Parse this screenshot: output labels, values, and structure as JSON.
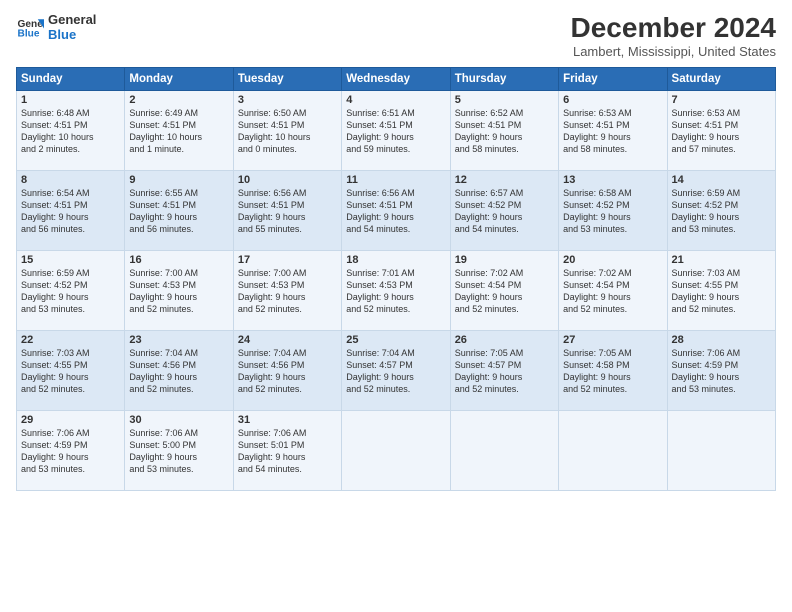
{
  "logo": {
    "line1": "General",
    "line2": "Blue"
  },
  "title": "December 2024",
  "subtitle": "Lambert, Mississippi, United States",
  "columns": [
    "Sunday",
    "Monday",
    "Tuesday",
    "Wednesday",
    "Thursday",
    "Friday",
    "Saturday"
  ],
  "weeks": [
    [
      {
        "day": "1",
        "info": "Sunrise: 6:48 AM\nSunset: 4:51 PM\nDaylight: 10 hours\nand 2 minutes."
      },
      {
        "day": "2",
        "info": "Sunrise: 6:49 AM\nSunset: 4:51 PM\nDaylight: 10 hours\nand 1 minute."
      },
      {
        "day": "3",
        "info": "Sunrise: 6:50 AM\nSunset: 4:51 PM\nDaylight: 10 hours\nand 0 minutes."
      },
      {
        "day": "4",
        "info": "Sunrise: 6:51 AM\nSunset: 4:51 PM\nDaylight: 9 hours\nand 59 minutes."
      },
      {
        "day": "5",
        "info": "Sunrise: 6:52 AM\nSunset: 4:51 PM\nDaylight: 9 hours\nand 58 minutes."
      },
      {
        "day": "6",
        "info": "Sunrise: 6:53 AM\nSunset: 4:51 PM\nDaylight: 9 hours\nand 58 minutes."
      },
      {
        "day": "7",
        "info": "Sunrise: 6:53 AM\nSunset: 4:51 PM\nDaylight: 9 hours\nand 57 minutes."
      }
    ],
    [
      {
        "day": "8",
        "info": "Sunrise: 6:54 AM\nSunset: 4:51 PM\nDaylight: 9 hours\nand 56 minutes."
      },
      {
        "day": "9",
        "info": "Sunrise: 6:55 AM\nSunset: 4:51 PM\nDaylight: 9 hours\nand 56 minutes."
      },
      {
        "day": "10",
        "info": "Sunrise: 6:56 AM\nSunset: 4:51 PM\nDaylight: 9 hours\nand 55 minutes."
      },
      {
        "day": "11",
        "info": "Sunrise: 6:56 AM\nSunset: 4:51 PM\nDaylight: 9 hours\nand 54 minutes."
      },
      {
        "day": "12",
        "info": "Sunrise: 6:57 AM\nSunset: 4:52 PM\nDaylight: 9 hours\nand 54 minutes."
      },
      {
        "day": "13",
        "info": "Sunrise: 6:58 AM\nSunset: 4:52 PM\nDaylight: 9 hours\nand 53 minutes."
      },
      {
        "day": "14",
        "info": "Sunrise: 6:59 AM\nSunset: 4:52 PM\nDaylight: 9 hours\nand 53 minutes."
      }
    ],
    [
      {
        "day": "15",
        "info": "Sunrise: 6:59 AM\nSunset: 4:52 PM\nDaylight: 9 hours\nand 53 minutes."
      },
      {
        "day": "16",
        "info": "Sunrise: 7:00 AM\nSunset: 4:53 PM\nDaylight: 9 hours\nand 52 minutes."
      },
      {
        "day": "17",
        "info": "Sunrise: 7:00 AM\nSunset: 4:53 PM\nDaylight: 9 hours\nand 52 minutes."
      },
      {
        "day": "18",
        "info": "Sunrise: 7:01 AM\nSunset: 4:53 PM\nDaylight: 9 hours\nand 52 minutes."
      },
      {
        "day": "19",
        "info": "Sunrise: 7:02 AM\nSunset: 4:54 PM\nDaylight: 9 hours\nand 52 minutes."
      },
      {
        "day": "20",
        "info": "Sunrise: 7:02 AM\nSunset: 4:54 PM\nDaylight: 9 hours\nand 52 minutes."
      },
      {
        "day": "21",
        "info": "Sunrise: 7:03 AM\nSunset: 4:55 PM\nDaylight: 9 hours\nand 52 minutes."
      }
    ],
    [
      {
        "day": "22",
        "info": "Sunrise: 7:03 AM\nSunset: 4:55 PM\nDaylight: 9 hours\nand 52 minutes."
      },
      {
        "day": "23",
        "info": "Sunrise: 7:04 AM\nSunset: 4:56 PM\nDaylight: 9 hours\nand 52 minutes."
      },
      {
        "day": "24",
        "info": "Sunrise: 7:04 AM\nSunset: 4:56 PM\nDaylight: 9 hours\nand 52 minutes."
      },
      {
        "day": "25",
        "info": "Sunrise: 7:04 AM\nSunset: 4:57 PM\nDaylight: 9 hours\nand 52 minutes."
      },
      {
        "day": "26",
        "info": "Sunrise: 7:05 AM\nSunset: 4:57 PM\nDaylight: 9 hours\nand 52 minutes."
      },
      {
        "day": "27",
        "info": "Sunrise: 7:05 AM\nSunset: 4:58 PM\nDaylight: 9 hours\nand 52 minutes."
      },
      {
        "day": "28",
        "info": "Sunrise: 7:06 AM\nSunset: 4:59 PM\nDaylight: 9 hours\nand 53 minutes."
      }
    ],
    [
      {
        "day": "29",
        "info": "Sunrise: 7:06 AM\nSunset: 4:59 PM\nDaylight: 9 hours\nand 53 minutes."
      },
      {
        "day": "30",
        "info": "Sunrise: 7:06 AM\nSunset: 5:00 PM\nDaylight: 9 hours\nand 53 minutes."
      },
      {
        "day": "31",
        "info": "Sunrise: 7:06 AM\nSunset: 5:01 PM\nDaylight: 9 hours\nand 54 minutes."
      },
      {
        "day": "",
        "info": ""
      },
      {
        "day": "",
        "info": ""
      },
      {
        "day": "",
        "info": ""
      },
      {
        "day": "",
        "info": ""
      }
    ]
  ]
}
